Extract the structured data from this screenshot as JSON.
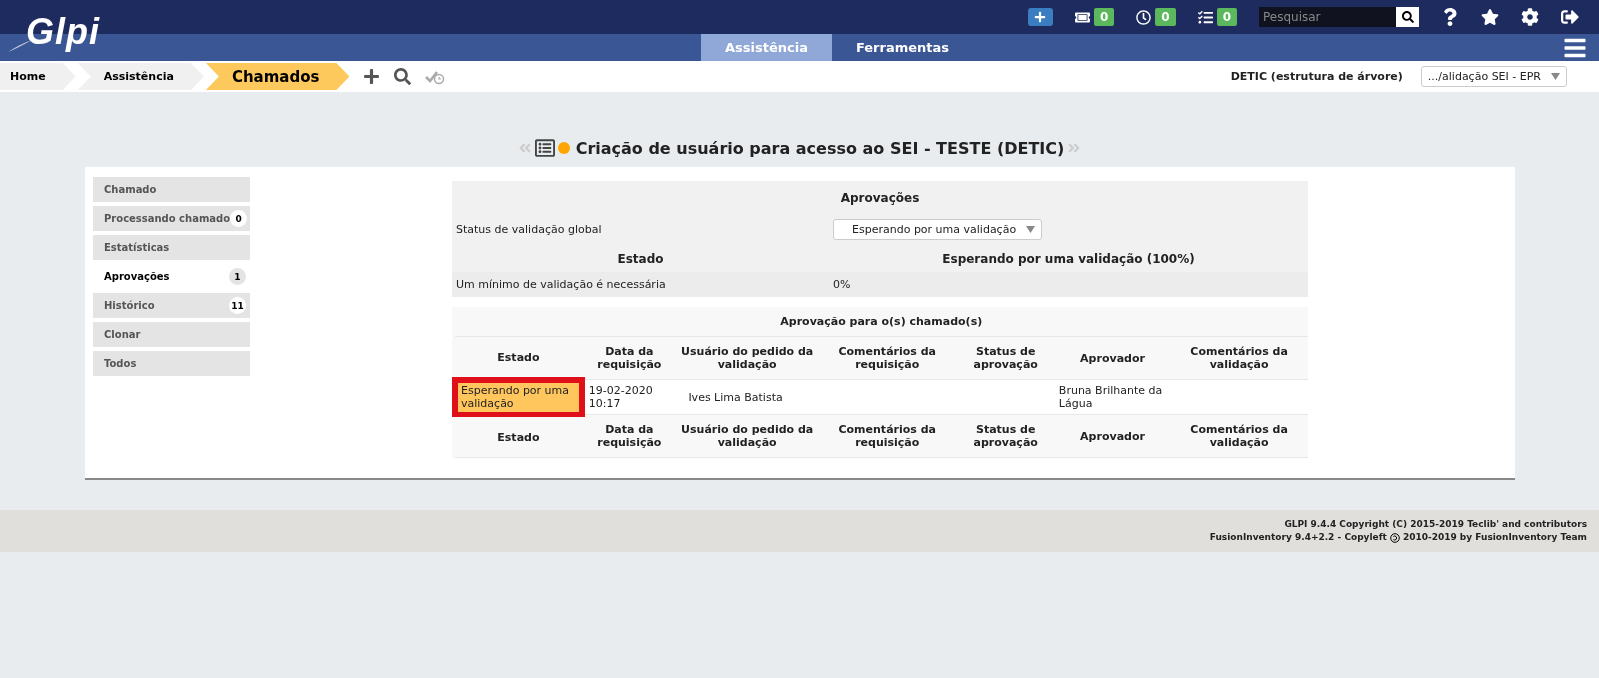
{
  "header": {
    "logo": "Glpi",
    "counters": [
      {
        "kind": "tickets",
        "count": "0"
      },
      {
        "kind": "clock",
        "count": "0"
      },
      {
        "kind": "tasks",
        "count": "0"
      }
    ],
    "search": {
      "placeholder": "Pesquisar"
    }
  },
  "menu": [
    {
      "label": "Assistência",
      "selected": true
    },
    {
      "label": "Ferramentas",
      "selected": false
    }
  ],
  "breadcrumbs": [
    {
      "label": "Home",
      "selected": false
    },
    {
      "label": "Assistência",
      "selected": false
    },
    {
      "label": "Chamados",
      "selected": true
    }
  ],
  "entity": {
    "label": "DETIC (estrutura de árvore)",
    "value": ".../alidação SEI - EPR"
  },
  "ticket": {
    "title": "Criação de usuário para acesso ao SEI - TESTE (DETIC)"
  },
  "sidebar": [
    {
      "label": "Chamado",
      "selected": false
    },
    {
      "label": "Processando chamado",
      "count": "0",
      "selected": false
    },
    {
      "label": "Estatísticas",
      "selected": false
    },
    {
      "label": "Aprovações",
      "count": "1",
      "selected": true
    },
    {
      "label": "Histórico",
      "count": "11",
      "selected": false
    },
    {
      "label": "Clonar",
      "selected": false
    },
    {
      "label": "Todos",
      "selected": false
    }
  ],
  "approvals": {
    "title": "Aprovações",
    "global_label": "Status de validação global",
    "global_value": "Esperando por uma validação",
    "state_heading": "Estado",
    "state_value": "Esperando por uma validação (100%)",
    "minimum_label": "Um mínimo de validação é necessária",
    "minimum_value": "0%"
  },
  "validations": {
    "title": "Aprovação para o(s) chamado(s)",
    "header_columns": [
      "Estado",
      "Data da requisição",
      "Usuário do pedido da validação",
      "Comentários da requisição",
      "Status de aprovação",
      "Aprovador",
      "Comentários da validação"
    ],
    "footer_columns": [
      "Estado",
      "Data da requisição",
      "Usuário do pedido da validação",
      "Comentários da requisição",
      "Status de aprovação",
      "Aprovador",
      "Comentários da validação"
    ],
    "rows": [
      {
        "status": "Esperando por uma validação",
        "color": "#ffc65d",
        "annotated": true,
        "date": "19-02-2020 10:17",
        "requester": "Ives Lima Batista",
        "approver": "Bruna Brilhante da Lágua"
      }
    ]
  },
  "footer": {
    "line1": "GLPI 9.4.4 Copyright (C) 2015-2019 Teclib' and contributors",
    "line2_start": "FusionInventory 9.4+2.2 - Copyleft",
    "line2_end": "2010-2019 by FusionInventory Team"
  }
}
